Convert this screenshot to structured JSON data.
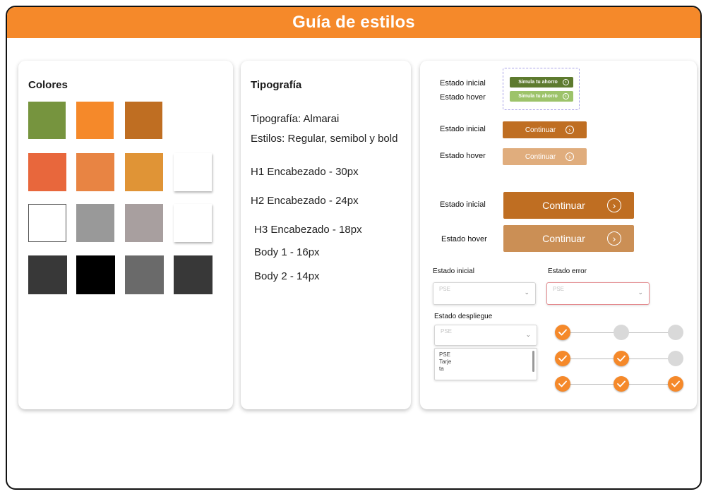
{
  "header": {
    "title": "Guía de estilos"
  },
  "colors": {
    "title": "Colores",
    "swatches": [
      "#76943e",
      "#f5892a",
      "#bf6e22",
      "#e8673c",
      "#e88443",
      "#e09436",
      "#ffffff",
      "#ffffff",
      "#999999",
      "#a89f9f",
      "#ffffff",
      "#383838",
      "#000000",
      "#6a6a6a",
      "#383838"
    ]
  },
  "typography": {
    "title": "Tipografía",
    "font": "Tipografía: Almarai",
    "styles": "Estilos: Regular, semibol y bold",
    "h1": "H1 Encabezado - 30px",
    "h2": "H2 Encabezado - 24px",
    "h3": "H3 Encabezado - 18px",
    "body1": "Body 1 - 16px",
    "body2": "Body 2 - 14px"
  },
  "components": {
    "initial_state": "Estado inicial",
    "hover_state": "Estado hover",
    "error_state": "Estado error",
    "dropdown_state": "Estado despliegue",
    "simulate_label": "Simula tu ahorro",
    "continue_label": "Continuar",
    "select_placeholder": "PSE",
    "dropdown_options": [
      "PSE",
      "Tarje",
      "ta"
    ],
    "accent": "#f5892a",
    "green": "#5d7a2e",
    "green_hover": "#9dc36a",
    "brown": "#bf6e22",
    "brown_hover": "#e0ad7d",
    "brown_large_hover": "#cb8f55"
  },
  "steppers": [
    [
      true,
      false,
      false
    ],
    [
      true,
      true,
      false
    ],
    [
      true,
      true,
      true
    ]
  ]
}
